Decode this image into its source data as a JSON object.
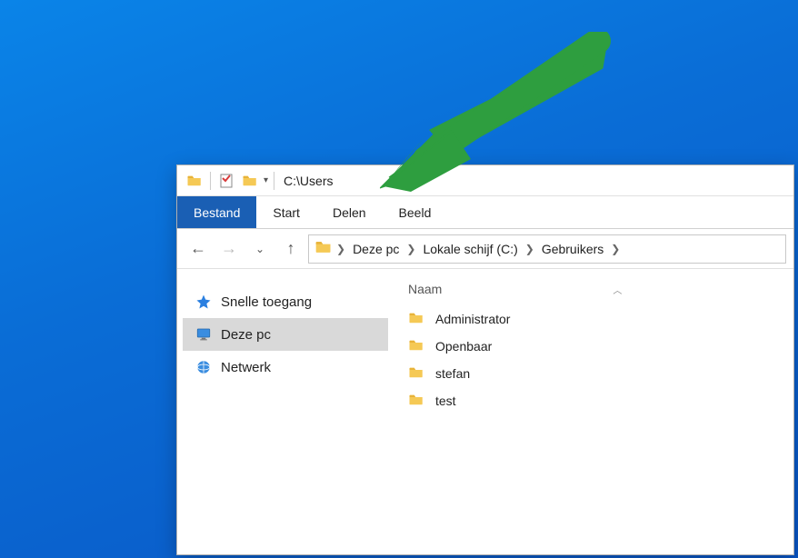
{
  "title": "C:\\Users",
  "ribbon": {
    "tabs": [
      {
        "label": "Bestand",
        "active": true
      },
      {
        "label": "Start",
        "active": false
      },
      {
        "label": "Delen",
        "active": false
      },
      {
        "label": "Beeld",
        "active": false
      }
    ]
  },
  "breadcrumb": {
    "segments": [
      "Deze pc",
      "Lokale schijf (C:)",
      "Gebruikers"
    ]
  },
  "sidebar": {
    "items": [
      {
        "label": "Snelle toegang",
        "icon": "star",
        "selected": false
      },
      {
        "label": "Deze pc",
        "icon": "monitor",
        "selected": true
      },
      {
        "label": "Netwerk",
        "icon": "network",
        "selected": false
      }
    ]
  },
  "columns": {
    "name": "Naam"
  },
  "files": [
    {
      "name": "Administrator"
    },
    {
      "name": "Openbaar"
    },
    {
      "name": "stefan"
    },
    {
      "name": "test"
    }
  ]
}
